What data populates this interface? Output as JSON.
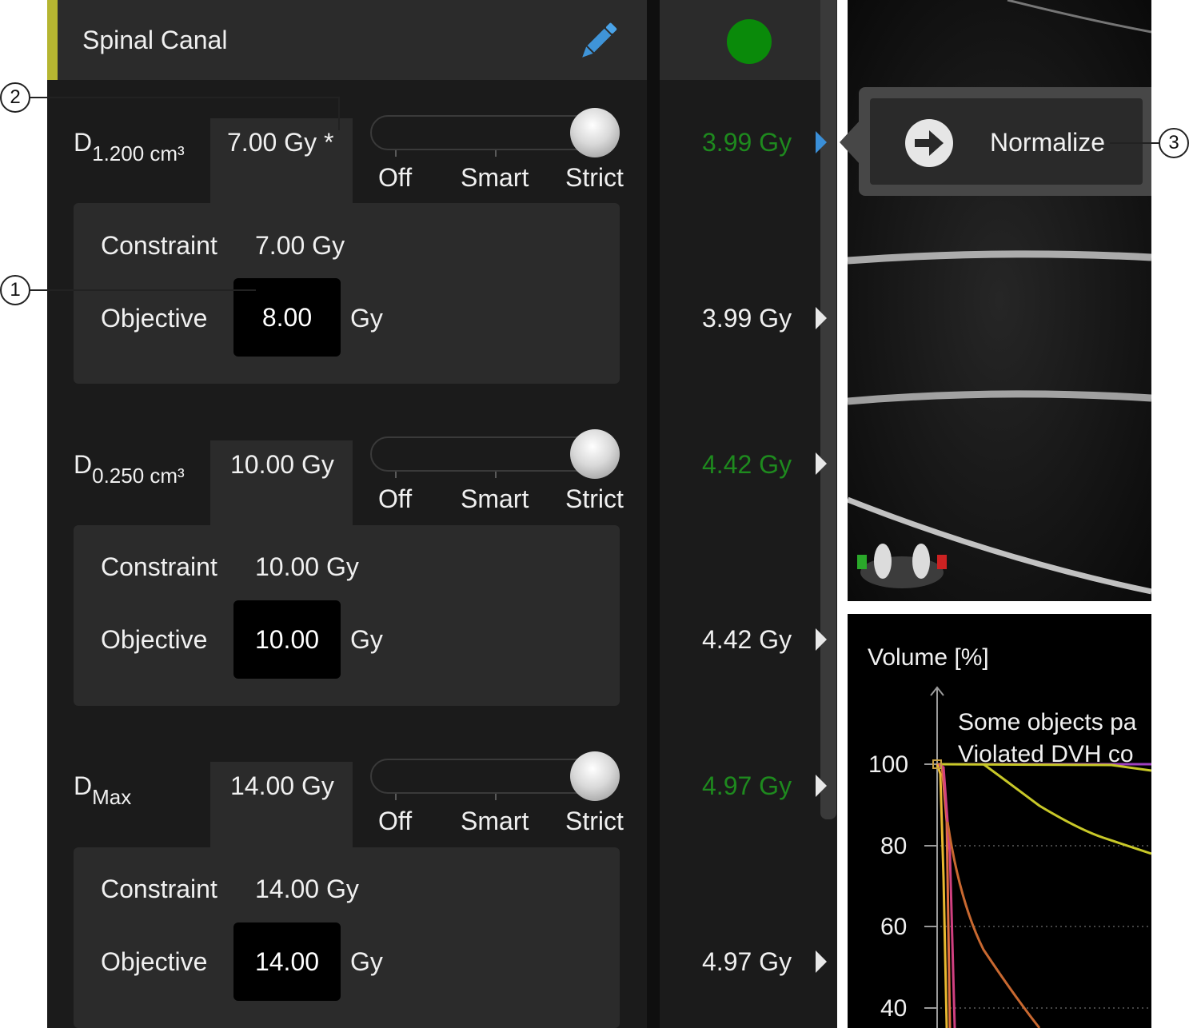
{
  "structure": {
    "name": "Spinal Canal",
    "status_color": "#0a8a0a",
    "accent_color": "#b5b531",
    "edit_icon": "pencil-icon"
  },
  "objectives": [
    {
      "metric_main": "D",
      "metric_sub": "1.200 cm³",
      "value": "7.00 Gy *",
      "slider": {
        "labels": [
          "Off",
          "Smart",
          "Strict"
        ],
        "selected": "Strict"
      },
      "constraint_label": "Constraint",
      "constraint_value": "7.00 Gy",
      "objective_label": "Objective",
      "objective_value": "8.00",
      "unit": "Gy",
      "achieved_top": "3.99 Gy",
      "achieved_bottom": "3.99 Gy"
    },
    {
      "metric_main": "D",
      "metric_sub": "0.250 cm³",
      "value": "10.00 Gy",
      "slider": {
        "labels": [
          "Off",
          "Smart",
          "Strict"
        ],
        "selected": "Strict"
      },
      "constraint_label": "Constraint",
      "constraint_value": "10.00 Gy",
      "objective_label": "Objective",
      "objective_value": "10.00",
      "unit": "Gy",
      "achieved_top": "4.42 Gy",
      "achieved_bottom": "4.42 Gy"
    },
    {
      "metric_main": "D",
      "metric_sub": "Max",
      "value": "14.00 Gy",
      "slider": {
        "labels": [
          "Off",
          "Smart",
          "Strict"
        ],
        "selected": "Strict"
      },
      "constraint_label": "Constraint",
      "constraint_value": "14.00 Gy",
      "objective_label": "Objective",
      "objective_value": "14.00",
      "unit": "Gy",
      "achieved_top": "4.97 Gy",
      "achieved_bottom": "4.97 Gy"
    }
  ],
  "normalize_button": {
    "label": "Normalize",
    "icon": "arrow-right-circle-icon"
  },
  "dvh": {
    "ylabel": "Volume [%]",
    "messages": [
      "Some objects pa",
      "Violated DVH co"
    ],
    "y_ticks": [
      "100",
      "80",
      "60",
      "40"
    ]
  },
  "callouts": [
    "1",
    "2",
    "3"
  ],
  "colors": {
    "achieved_green": "#1e8a1e",
    "highlight_arrow": "#3a8fd8"
  }
}
